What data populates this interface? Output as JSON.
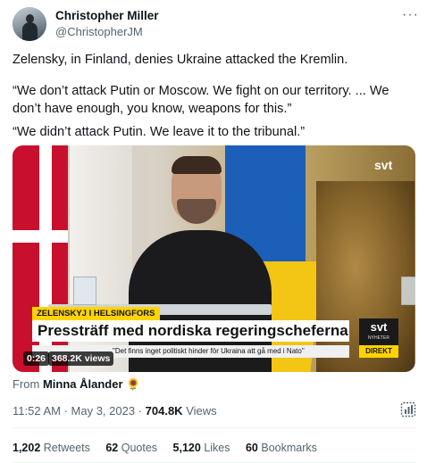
{
  "author": {
    "name": "Christopher Miller",
    "handle": "@ChristopherJM"
  },
  "tweet": {
    "paragraphs": [
      "Zelensky, in Finland, denies Ukraine attacked the Kremlin.",
      "“We don’t attack Putin or Moscow. We fight on our territory. ... We don’t have enough, you know, weapons for this.”",
      "“We didn’t attack Putin. We leave it to the tribunal.”"
    ]
  },
  "video": {
    "broadcaster_logo": "svt",
    "kicker": "ZELENSKYJ I HELSINGFORS",
    "headline": "Pressträff med nordiska regeringscheferna",
    "ticker": "\"Det finns inget politiskt hinder för Ukraina att gå med i Nato\"",
    "corner_logo": "svt",
    "corner_logo_sub": "NYHETER",
    "live_label": "DIREKT",
    "duration": "0:26",
    "views": "368.2K views"
  },
  "attribution": {
    "prefix": "From",
    "source": "Minna Ålander 🌻"
  },
  "meta": {
    "time": "11:52 AM",
    "date": "May 3, 2023",
    "views_count": "704.8K",
    "views_label": "Views"
  },
  "stats": [
    {
      "count": "1,202",
      "label": "Retweets"
    },
    {
      "count": "62",
      "label": "Quotes"
    },
    {
      "count": "5,120",
      "label": "Likes"
    },
    {
      "count": "60",
      "label": "Bookmarks"
    }
  ],
  "icons": [
    "more-icon",
    "analytics-icon"
  ],
  "colors": {
    "text": "#0f1419",
    "secondary": "#536471",
    "divider": "#eff3f4",
    "kicker_yellow": "#ffd400"
  }
}
